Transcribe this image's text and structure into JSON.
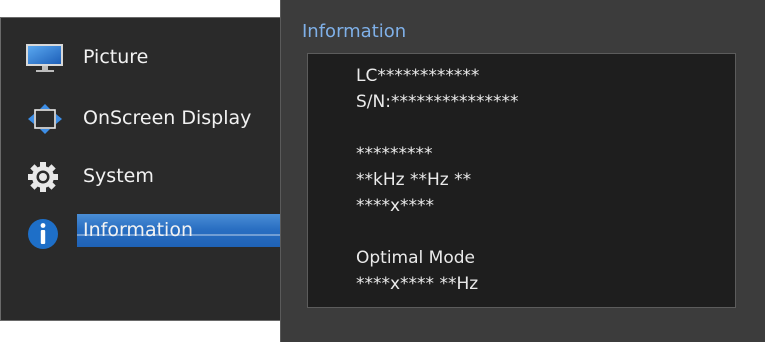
{
  "menu": {
    "items": [
      {
        "label": "Picture",
        "icon": "monitor-icon"
      },
      {
        "label": "OnScreen Display",
        "icon": "screen-arrows-icon"
      },
      {
        "label": "System",
        "icon": "gear-icon"
      },
      {
        "label": "Information",
        "icon": "info-icon",
        "selected": true
      }
    ]
  },
  "panel": {
    "title": "Information",
    "lines": [
      "LC************",
      "S/N:***************",
      "*********",
      "**kHz **Hz **",
      "****x****",
      "Optimal Mode",
      "****x**** **Hz"
    ]
  },
  "colors": {
    "accent": "#2a6fc2",
    "title_text": "#7fb0e8",
    "menu_bg": "#2a2a2a",
    "panel_bg": "#3c3c3c",
    "info_box_bg": "#1e1e1e",
    "info_icon": "#1e6fc8"
  }
}
